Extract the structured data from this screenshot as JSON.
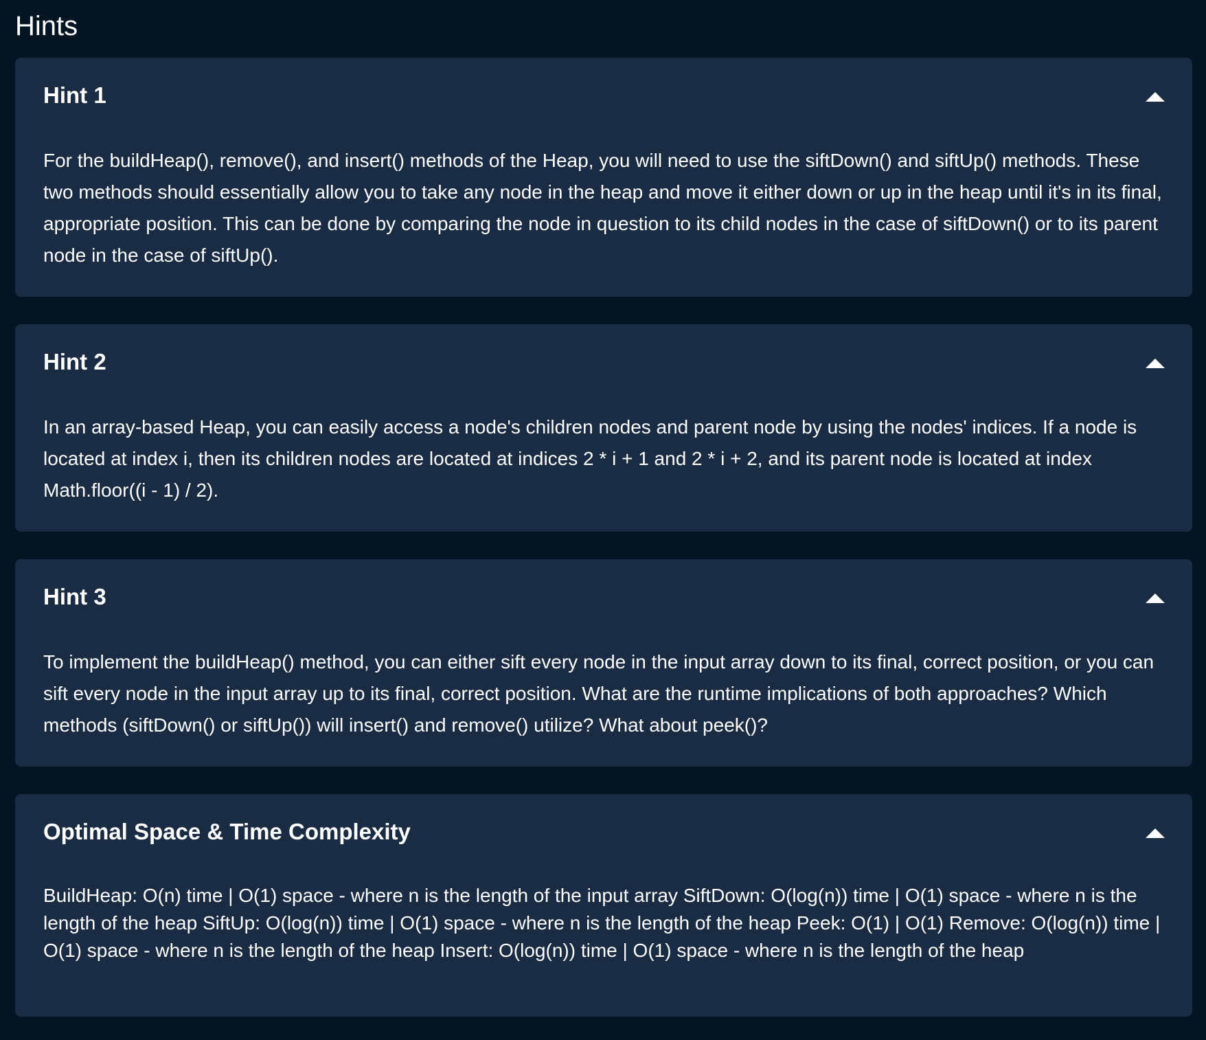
{
  "page": {
    "title": "Hints"
  },
  "hints": [
    {
      "title": "Hint 1",
      "body": "For the buildHeap(), remove(), and insert() methods of the Heap, you will need to use the siftDown() and siftUp() methods. These two methods should essentially allow you to take any node in the heap and move it either down or up in the heap until it's in its final, appropriate position. This can be done by comparing the node in question to its child nodes in the case of siftDown() or to its parent node in the case of siftUp().",
      "expanded": true,
      "icon": "chevron-up-icon"
    },
    {
      "title": "Hint 2",
      "body": "In an array-based Heap, you can easily access a node's children nodes and parent node by using the nodes' indices. If a node is located at index i, then its children nodes are located at indices 2 * i + 1 and 2 * i + 2, and its parent node is located at index Math.floor((i - 1) / 2).",
      "expanded": true,
      "icon": "chevron-up-icon"
    },
    {
      "title": "Hint 3",
      "body": "To implement the buildHeap() method, you can either sift every node in the input array down to its final, correct position, or you can sift every node in the input array up to its final, correct position. What are the runtime implications of both approaches? Which methods (siftDown() or siftUp()) will insert() and remove() utilize? What about peek()?",
      "expanded": true,
      "icon": "chevron-up-icon"
    },
    {
      "title": "Optimal Space & Time Complexity",
      "body": "BuildHeap: O(n) time | O(1) space - where n is the length of the input array SiftDown: O(log(n)) time | O(1) space - where n is the length of the heap SiftUp: O(log(n)) time | O(1) space - where n is the length of the heap Peek: O(1) | O(1) Remove: O(log(n)) time | O(1) space - where n is the length of the heap Insert: O(log(n)) time | O(1) space - where n is the length of the heap",
      "expanded": true,
      "icon": "chevron-up-icon"
    }
  ],
  "colors": {
    "background": "#031422",
    "panel": "#192c43",
    "text": "#ffffff"
  }
}
